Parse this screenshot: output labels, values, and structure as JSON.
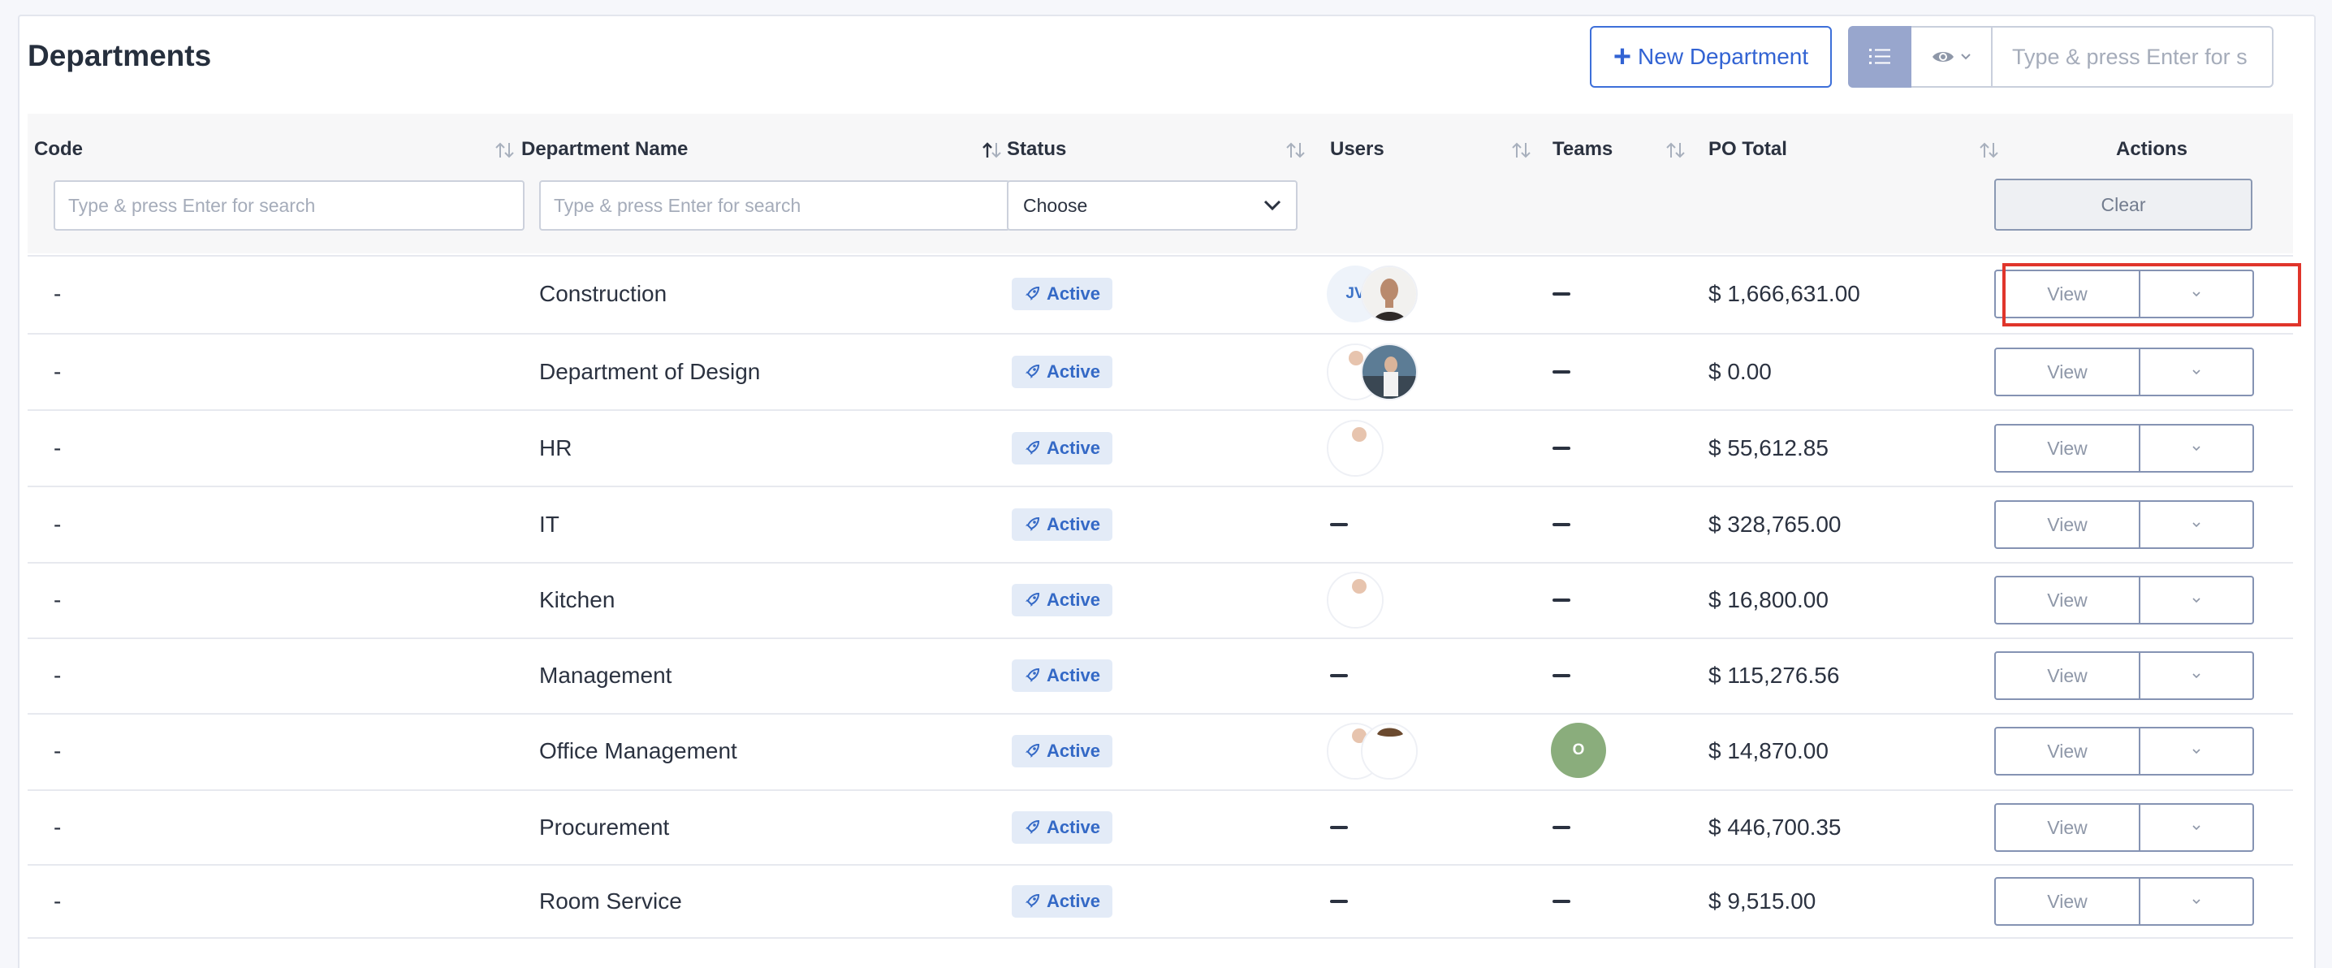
{
  "page": {
    "title": "Departments",
    "new_button_label": "New Department",
    "search_placeholder": "Type & press Enter for s"
  },
  "table": {
    "columns": {
      "code": "Code",
      "department_name": "Department Name",
      "status": "Status",
      "users": "Users",
      "teams": "Teams",
      "po_total": "PO Total",
      "actions": "Actions"
    },
    "filters": {
      "code_placeholder": "Type & press Enter for search",
      "name_placeholder": "Type & press Enter for search",
      "status_select": "Choose",
      "clear_label": "Clear"
    },
    "status_label": "Active",
    "view_label": "View",
    "rows": [
      {
        "code": "-",
        "name": "Construction",
        "po_total": "$ 1,666,631.00",
        "users": [
          "JV",
          "photo"
        ],
        "teams": "-"
      },
      {
        "code": "-",
        "name": "Department of Design",
        "po_total": "$ 0.00",
        "users": [
          "photo",
          "photo"
        ],
        "teams": "-"
      },
      {
        "code": "-",
        "name": "HR",
        "po_total": "$ 55,612.85",
        "users": [
          "photo"
        ],
        "teams": "-"
      },
      {
        "code": "-",
        "name": "IT",
        "po_total": "$ 328,765.00",
        "users": [],
        "teams": "-"
      },
      {
        "code": "-",
        "name": "Kitchen",
        "po_total": "$ 16,800.00",
        "users": [
          "photo"
        ],
        "teams": "-"
      },
      {
        "code": "-",
        "name": "Management",
        "po_total": "$ 115,276.56",
        "users": [],
        "teams": "-"
      },
      {
        "code": "-",
        "name": "Office Management",
        "po_total": "$ 14,870.00",
        "users": [
          "photo",
          "photo"
        ],
        "teams": "O"
      },
      {
        "code": "-",
        "name": "Procurement",
        "po_total": "$ 446,700.35",
        "users": [],
        "teams": "-"
      },
      {
        "code": "-",
        "name": "Room Service",
        "po_total": "$ 9,515.00",
        "users": [],
        "teams": "-"
      }
    ]
  },
  "colors": {
    "primary": "#3263d3",
    "status_badge_bg": "#e3ebf7",
    "highlight": "#e0352b",
    "team_avatar": "#8aad7c"
  }
}
